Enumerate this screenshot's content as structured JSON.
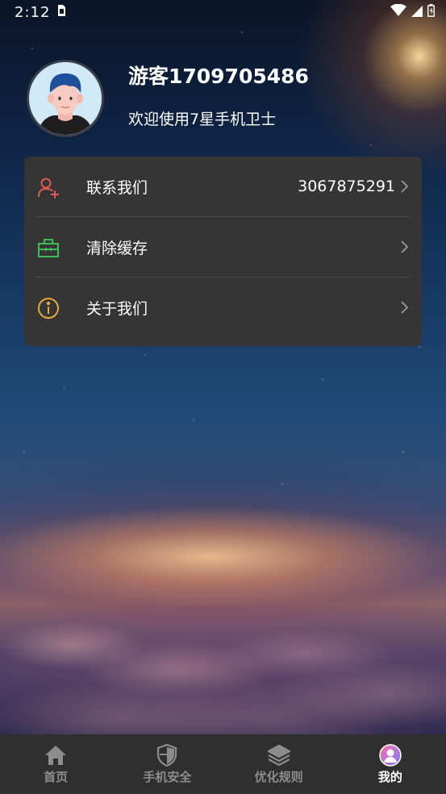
{
  "status_bar": {
    "time": "2:12"
  },
  "profile": {
    "username": "游客1709705486",
    "welcome": "欢迎使用7星手机卫士"
  },
  "menu": {
    "items": [
      {
        "icon": "add-contact-icon",
        "label": "联系我们",
        "value": "3067875291",
        "color": "#e05a4f"
      },
      {
        "icon": "toolbox-icon",
        "label": "清除缓存",
        "value": "",
        "color": "#3dbb57"
      },
      {
        "icon": "info-icon",
        "label": "关于我们",
        "value": "",
        "color": "#e8a93a"
      }
    ]
  },
  "tabs": [
    {
      "icon": "home-icon",
      "label": "首页",
      "active": false
    },
    {
      "icon": "shield-icon",
      "label": "手机安全",
      "active": false
    },
    {
      "icon": "layers-icon",
      "label": "优化规则",
      "active": false
    },
    {
      "icon": "profile-icon",
      "label": "我的",
      "active": true
    }
  ],
  "colors": {
    "card_bg": "#353535",
    "tab_bar_bg": "#2f2f2f",
    "tab_inactive": "#8d8d8d",
    "tab_active": "#ffffff"
  }
}
